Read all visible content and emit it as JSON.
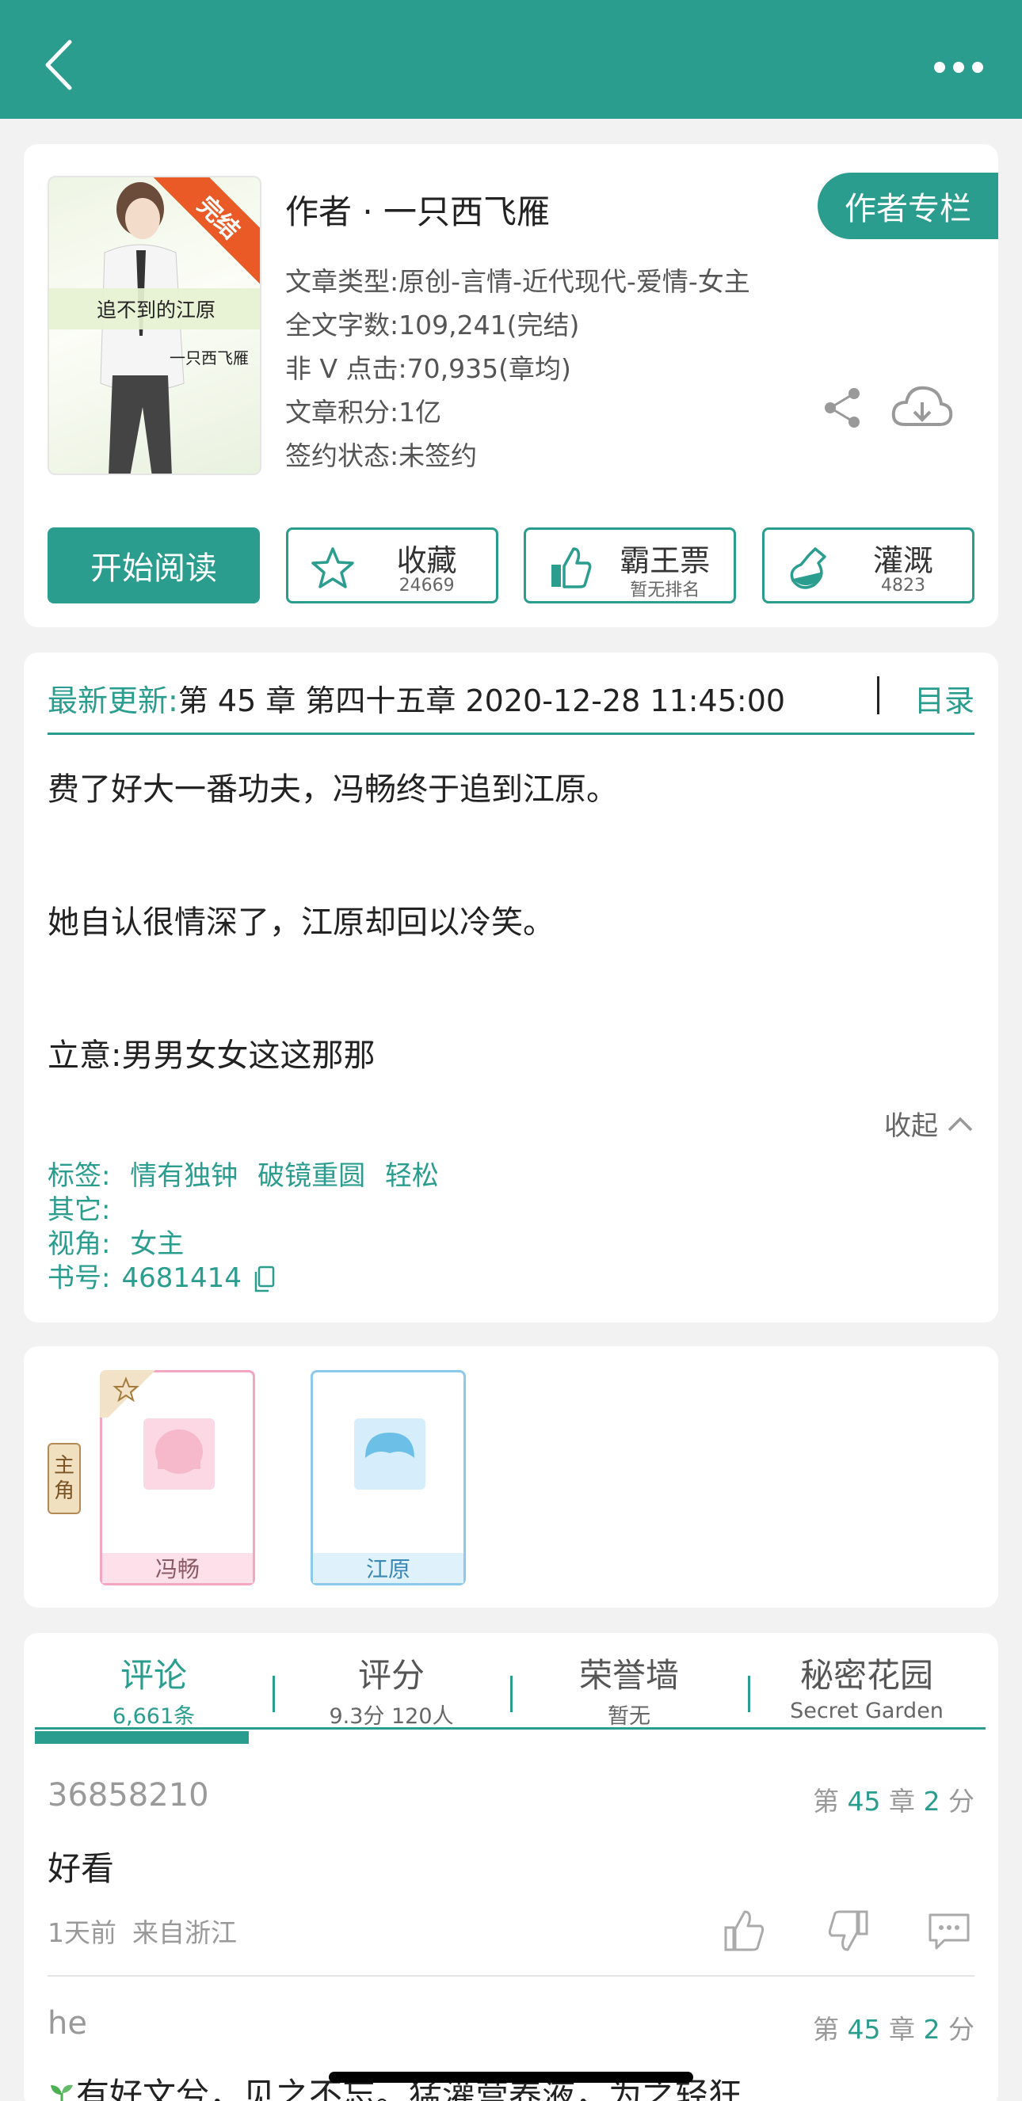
{
  "header": {
    "title": "",
    "back_icon": "back-icon",
    "more_icon": "more-icon"
  },
  "book": {
    "cover": {
      "status_ribbon": "完结",
      "title": "追不到的江原",
      "author": "一只西飞雁"
    },
    "author_line": "作者 · 一只西飞雁",
    "author_column_button": "作者专栏",
    "meta": [
      "文章类型:原创-言情-近代现代-爱情-女主",
      "全文字数:109,241(完结)",
      "非 V 点击:70,935(章均)",
      "文章积分:1亿",
      "签约状态:未签约"
    ]
  },
  "actions": {
    "start_reading": "开始阅读",
    "favorite": {
      "label": "收藏",
      "sub": "24669",
      "icon": "star-icon"
    },
    "vote": {
      "label": "霸王票",
      "sub": "暂无排名",
      "icon": "thumbs-up-icon"
    },
    "water": {
      "label": "灌溉",
      "sub": "4823",
      "icon": "watering-flask-icon"
    }
  },
  "update": {
    "label": "最新更新:",
    "text": " 第 45 章 第四十五章 2020-12-28 11:45:00",
    "toc": "目录"
  },
  "summary": {
    "p1": "费了好大一番功夫，冯畅终于追到江原。",
    "p2": "她自认很情深了，江原却回以冷笑。",
    "p3": "立意:男男女女这这那那",
    "collapse": "收起"
  },
  "tags": {
    "tags_label": "标签:",
    "tag1": "情有独钟",
    "tag2": "破镜重圆",
    "tag3": "轻松",
    "other_label": "其它:",
    "pov_label": "视角:",
    "pov": "女主",
    "id_label": "书号:",
    "id": "4681414"
  },
  "roles": {
    "tag": [
      "主",
      "角"
    ],
    "items": [
      {
        "name": "冯畅",
        "color": "#f3a6bf"
      },
      {
        "name": "江原",
        "color": "#8cc9ea"
      }
    ]
  },
  "tabs": [
    {
      "title": "评论",
      "sub": "6,661条"
    },
    {
      "title": "评分",
      "sub": "9.3分 120人"
    },
    {
      "title": "荣誉墙",
      "sub": "暂无"
    },
    {
      "title": "秘密花园",
      "sub": "Secret Garden"
    }
  ],
  "comments": [
    {
      "user": "36858210",
      "chap_pre": "第 ",
      "chap": "45",
      "chap_mid": " 章 ",
      "score": "2",
      "chap_post": " 分",
      "text": "好看",
      "time": "1天前",
      "from": "来自浙江"
    },
    {
      "user": "he",
      "chap_pre": "第 ",
      "chap": "45",
      "chap_mid": " 章 ",
      "score": "2",
      "chap_post": " 分",
      "text": "有好文兮，见之不忘。猛灌营养液，为之轻狂"
    }
  ],
  "colors": {
    "accent": "#2a9d8f",
    "ribbon": "#e95a26"
  }
}
